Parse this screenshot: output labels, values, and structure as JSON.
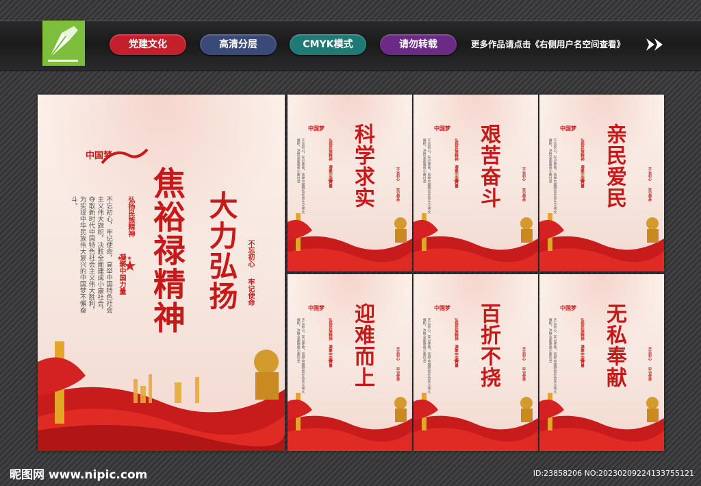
{
  "header": {
    "tags": [
      {
        "label": "党建文化",
        "color": "#c4202b"
      },
      {
        "label": "高清分层",
        "color": "#3a4a78"
      },
      {
        "label": "CMYK模式",
        "color": "#1f7a75"
      },
      {
        "label": "请勿转载",
        "color": "#6b2a86"
      }
    ],
    "notice": "更多作品请点击《右侧用户名空间查看》",
    "logo_icon": "pen-nib-icon",
    "arrow_icon": "double-arrow-icon"
  },
  "main_poster": {
    "brand": "中国梦",
    "title_line1": "焦裕禄精神",
    "title_line2": "大力弘扬",
    "slogan_a": "不忘初心",
    "slogan_b": "牢记使命",
    "sub_a": "弘扬民族精神",
    "sub_b": "凝聚中国力量",
    "body": "不忘初心，牢记使命，高举中国特色社会主义伟大旗帜，决胜全面建成小康社会，夺取新时代中国特色社会主义伟大胜利，为实现中华民族伟大复兴的中国梦不懈奋斗。"
  },
  "small_posters": [
    {
      "title": "科学求实"
    },
    {
      "title": "艰苦奋斗"
    },
    {
      "title": "亲民爱民"
    },
    {
      "title": "迎难而上"
    },
    {
      "title": "百折不挠"
    },
    {
      "title": "无私奉献"
    }
  ],
  "small_common": {
    "brand": "中国梦",
    "sub": "弘扬民族精神 凝聚中国力量",
    "slogan_a": "不忘初心",
    "slogan_b": "牢记使命",
    "body": "不忘初心，牢记使命，高举中国特色社会主义伟大旗帜，决胜全面建成小康社会"
  },
  "footer": {
    "site": "昵图网 www.nipic.com",
    "id": "ID:23858206 NO:20230209224133755121"
  }
}
